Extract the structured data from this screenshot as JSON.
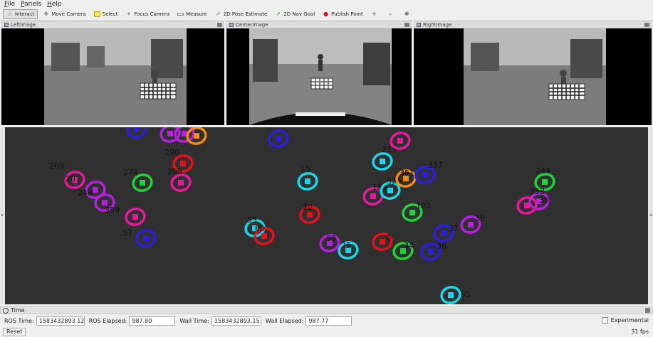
{
  "menu": [
    "File",
    "Panels",
    "Help"
  ],
  "toolbar": [
    {
      "label": "Interact",
      "icon": "interact-icon",
      "active": true
    },
    {
      "label": "Move Camera",
      "icon": "move-camera-icon"
    },
    {
      "label": "Select",
      "icon": "select-icon"
    },
    {
      "label": "Focus Camera",
      "icon": "focus-camera-icon"
    },
    {
      "label": "Measure",
      "icon": "measure-icon"
    },
    {
      "label": "2D Pose Estimate",
      "icon": "pose-estimate-icon"
    },
    {
      "label": "2D Nav Goal",
      "icon": "nav-goal-icon"
    },
    {
      "label": "Publish Point",
      "icon": "publish-point-icon"
    }
  ],
  "panels": [
    "LeftImage",
    "CenterImage",
    "RightImage"
  ],
  "colors": {
    "red": "#e8101a",
    "magenta": "#e8189c",
    "purple": "#b61ee0",
    "blue": "#2a1fe0",
    "cyan": "#19d6e8",
    "green": "#22d13a",
    "orange": "#f08a10"
  },
  "markers": [
    {
      "id": "",
      "color": "blue"
    },
    {
      "id": "",
      "color": "purple"
    },
    {
      "id": "",
      "color": "purple"
    },
    {
      "id": "",
      "color": "orange"
    },
    {
      "id": "",
      "color": "blue"
    },
    {
      "id": "269",
      "color": ""
    },
    {
      "id": "290",
      "color": "red"
    },
    {
      "id": "298",
      "color": "magenta"
    },
    {
      "id": "274",
      "color": "green"
    },
    {
      "id": "201",
      "color": "magenta"
    },
    {
      "id": "248",
      "color": "purple"
    },
    {
      "id": "",
      "color": "purple"
    },
    {
      "id": "359",
      "color": "magenta"
    },
    {
      "id": "57",
      "color": "blue"
    },
    {
      "id": "15",
      "color": "cyan"
    },
    {
      "id": "20",
      "color": "red"
    },
    {
      "id": "55",
      "color": "cyan"
    },
    {
      "id": "60",
      "color": "red"
    },
    {
      "id": "59",
      "color": "purple"
    },
    {
      "id": "25",
      "color": "cyan"
    },
    {
      "id": "0",
      "color": "red"
    },
    {
      "id": "34",
      "color": "green"
    },
    {
      "id": "36",
      "color": "blue"
    },
    {
      "id": "37",
      "color": "blue"
    },
    {
      "id": "38",
      "color": "purple"
    },
    {
      "id": "193",
      "color": "green"
    },
    {
      "id": "139",
      "color": "magenta"
    },
    {
      "id": "325",
      "color": "cyan"
    },
    {
      "id": "351",
      "color": "orange"
    },
    {
      "id": "337",
      "color": "blue"
    },
    {
      "id": "213",
      "color": "cyan"
    },
    {
      "id": "",
      "color": "magenta"
    },
    {
      "id": "244",
      "color": "green"
    },
    {
      "id": "358",
      "color": "purple"
    },
    {
      "id": "39",
      "color": "magenta"
    },
    {
      "id": "35",
      "color": "cyan"
    }
  ],
  "time": {
    "panel_title": "Time",
    "ros_time_label": "ROS Time:",
    "ros_time": "1583432893.12",
    "ros_elapsed_label": "ROS Elapsed:",
    "ros_elapsed": "987.80",
    "wall_time_label": "Wall Time:",
    "wall_time": "1583432893.15",
    "wall_elapsed_label": "Wall Elapsed:",
    "wall_elapsed": "987.77",
    "experimental_label": "Experimental"
  },
  "reset_label": "Reset",
  "fps": "31 fps"
}
